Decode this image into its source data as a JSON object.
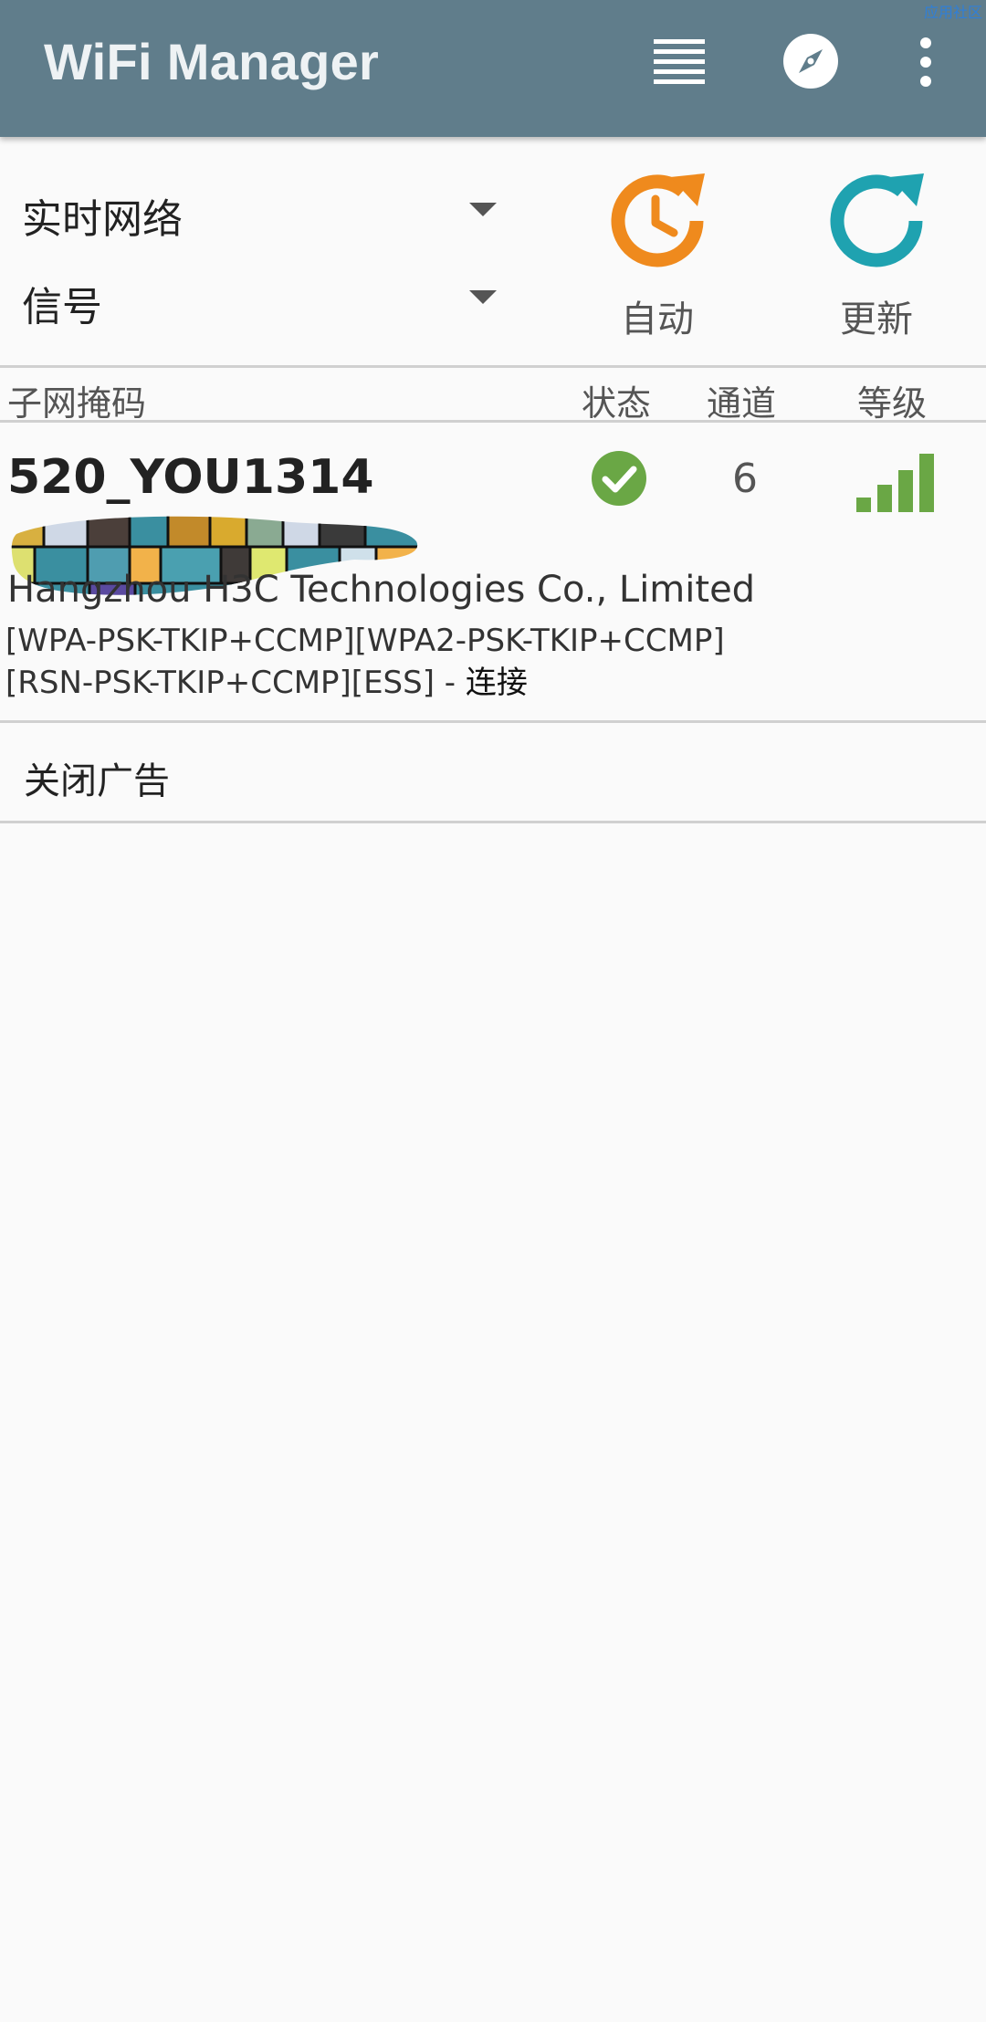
{
  "app": {
    "title": "WiFi Manager",
    "watermark": "应用社区"
  },
  "toolbar": {
    "icons": [
      "list-icon",
      "compass-icon",
      "more-vert-icon"
    ]
  },
  "controls": {
    "mode_selected": "实时网络",
    "sort_selected": "信号",
    "auto_label": "自动",
    "refresh_label": "更新",
    "auto_color": "#ef8a1d",
    "refresh_color": "#1fa2b0"
  },
  "table_header": {
    "col_name": "子网掩码",
    "col_status": "状态",
    "col_channel": "通道",
    "col_level": "等级"
  },
  "networks": [
    {
      "ssid": "520_YOU1314",
      "vendor": "Hangzhou H3C Technologies Co., Limited",
      "caps_line1": "[WPA-PSK-TKIP+CCMP][WPA2-PSK-TKIP+CCMP]",
      "caps_line2": "[RSN-PSK-TKIP+CCMP][ESS] - ",
      "connection": "连接",
      "status": "connected",
      "status_color": "#6aa745",
      "channel": "6",
      "signal_bars": 4,
      "signal_max": 4,
      "signal_color": "#6aa745"
    }
  ],
  "ad": {
    "close_label": "关闭广告"
  }
}
